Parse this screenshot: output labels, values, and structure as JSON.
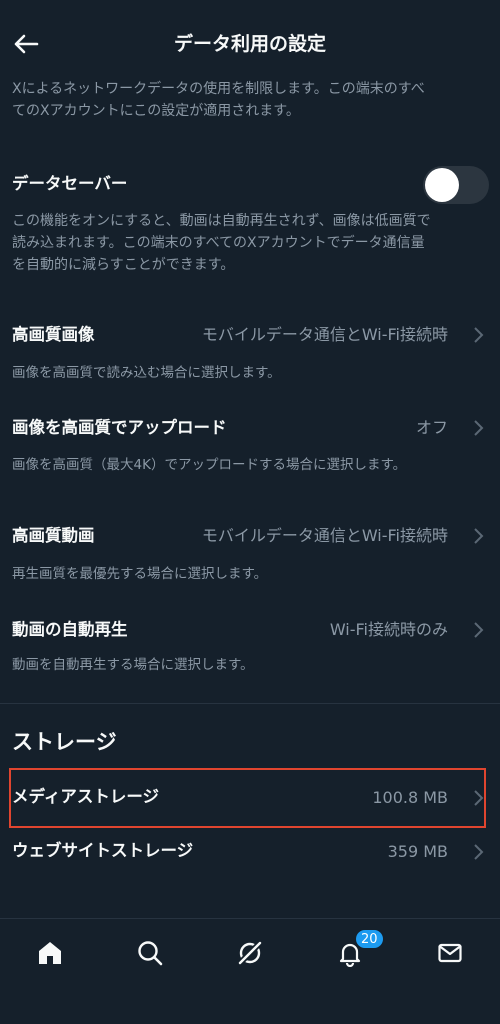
{
  "header": {
    "title": "データ利用の設定"
  },
  "intro": {
    "line1": "Xによるネットワークデータの使用を制限します。この端末のすべ",
    "line2": "てのXアカウントにこの設定が適用されます。"
  },
  "data_saver": {
    "label": "データセーバー",
    "enabled": false,
    "desc_line1": "この機能をオンにすると、動画は自動再生されず、画像は低画質で",
    "desc_line2": "読み込まれます。この端末のすべてのXアカウントでデータ通信量",
    "desc_line3": "を自動的に減らすことができます。"
  },
  "settings": [
    {
      "label": "高画質画像",
      "value": "モバイルデータ通信とWi-Fi接続時",
      "description": "画像を高画質で読み込む場合に選択します。"
    },
    {
      "label": "画像を高画質でアップロード",
      "value": "オフ",
      "description": "画像を高画質（最大4K）でアップロードする場合に選択します。"
    },
    {
      "label": "高画質動画",
      "value": "モバイルデータ通信とWi-Fi接続時",
      "description": "再生画質を最優先する場合に選択します。"
    },
    {
      "label": "動画の自動再生",
      "value": "Wi-Fi接続時のみ",
      "description": "動画を自動再生する場合に選択します。"
    }
  ],
  "storage": {
    "section_title": "ストレージ",
    "items": [
      {
        "label": "メディアストレージ",
        "value": "100.8 MB"
      },
      {
        "label": "ウェブサイトストレージ",
        "value": "359 MB"
      }
    ]
  },
  "tabbar": {
    "notification_count": "20",
    "icons": [
      "home-icon",
      "search-icon",
      "grok-icon",
      "bell-icon",
      "mail-icon"
    ]
  },
  "colors": {
    "background": "#15202b",
    "highlight_border": "#e0452f",
    "badge": "#1d9bf0",
    "secondary_text": "#8b98a5"
  }
}
